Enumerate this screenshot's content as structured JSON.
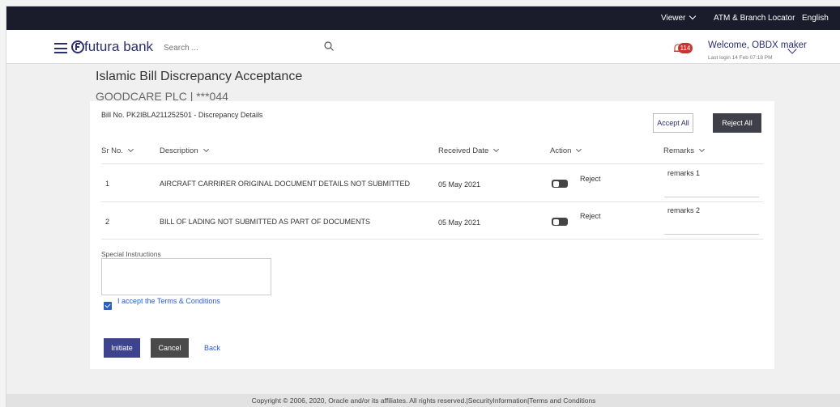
{
  "topbar": {
    "viewer_label": "Viewer",
    "atm_label": "ATM & Branch Locator",
    "language_label": "English"
  },
  "header": {
    "brand": "futura bank",
    "search_placeholder": "Search ...",
    "notification_count": "114",
    "welcome_text": "Welcome, OBDX maker",
    "last_login": "Last login 14 Feb 07:18 PM"
  },
  "page": {
    "title": "Islamic Bill Discrepancy Acceptance",
    "party": "GOODCARE PLC | ***044"
  },
  "bill": {
    "title": "Bill No. PK2IBLA211252501 - Discrepancy Details",
    "accept_all_label": "Accept All",
    "reject_all_label": "Reject All"
  },
  "table": {
    "headers": {
      "sr_no": "Sr No.",
      "description": "Description",
      "received_date": "Received Date",
      "action": "Action",
      "remarks": "Remarks"
    },
    "rows": [
      {
        "sr_no": "1",
        "description": "AIRCRAFT CARRIRER ORIGINAL DOCUMENT DETAILS NOT SUBMITTED",
        "received_date": "05 May 2021",
        "action_label": "Reject",
        "remarks": "remarks 1"
      },
      {
        "sr_no": "2",
        "description": "BILL OF LADING NOT SUBMITTED AS PART OF DOCUMENTS",
        "received_date": "05 May 2021",
        "action_label": "Reject",
        "remarks": "remarks 2"
      }
    ]
  },
  "form": {
    "special_instructions_label": "Special Instructions",
    "special_instructions_value": "",
    "terms_label": "I accept the Terms & Conditions",
    "terms_checked": true,
    "initiate_label": "Initiate",
    "cancel_label": "Cancel",
    "back_label": "Back"
  },
  "footer": {
    "text": "Copyright © 2006, 2020, Oracle and/or its affiliates. All rights reserved.|SecurityInformation|Terms and Conditions"
  },
  "colors": {
    "topbar_bg": "#1a1b2b",
    "brand": "#2b2f6e",
    "primary_button": "#3e438f",
    "dark_button": "#3e3f49",
    "link": "#2b5fbf",
    "badge": "#c8352e"
  }
}
